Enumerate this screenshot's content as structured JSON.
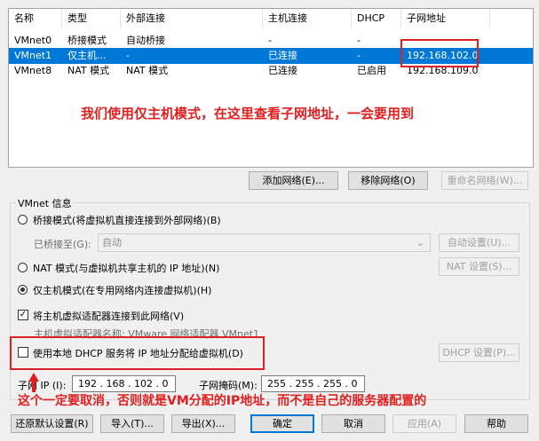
{
  "table": {
    "headers": [
      "名称",
      "类型",
      "外部连接",
      "主机连接",
      "DHCP",
      "子网地址"
    ],
    "rows": [
      {
        "name": "VMnet0",
        "type": "桥接模式",
        "external": "自动桥接",
        "host": "-",
        "dhcp": "-",
        "subnet": ""
      },
      {
        "name": "VMnet1",
        "type": "仅主机...",
        "external": "-",
        "host": "已连接",
        "dhcp": "-",
        "subnet": "192.168.102.0"
      },
      {
        "name": "VMnet8",
        "type": "NAT 模式",
        "external": "NAT 模式",
        "host": "已连接",
        "dhcp": "已启用",
        "subnet": "192.168.109.0"
      }
    ]
  },
  "annotations": {
    "top": "我们使用仅主机模式，在这里查看子网地址，一会要用到",
    "bottom": "这个一定要取消，否则就是VM分配的IP地址，而不是自己的服务器配置的"
  },
  "table_buttons": {
    "add": "添加网络(E)...",
    "remove": "移除网络(O)",
    "rename": "重命名网络(W)..."
  },
  "vmnet_info": {
    "title": "VMnet 信息",
    "bridged_label": "桥接模式(将虚拟机直接连接到外部网络)(B)",
    "bridged_to_label": "已桥接至(G):",
    "bridged_to_value": "自动",
    "auto_settings": "自动设置(U)...",
    "nat_label": "NAT 模式(与虚拟机共享主机的 IP 地址)(N)",
    "nat_settings": "NAT 设置(S)...",
    "hostonly_label": "仅主机模式(在专用网络内连接虚拟机)(H)",
    "connect_adapter_label": "将主机虚拟适配器连接到此网络(V)",
    "adapter_name_label": "主机虚拟适配器名称: VMware 网络适配器 VMnet1",
    "dhcp_label": "使用本地 DHCP 服务将 IP 地址分配给虚拟机(D)",
    "dhcp_settings": "DHCP 设置(P)...",
    "subnet_ip_label": "子网 IP (I):",
    "subnet_ip_value": "192 . 168 . 102 . 0",
    "subnet_mask_label": "子网掩码(M):",
    "subnet_mask_value": "255 . 255 . 255 . 0"
  },
  "footer": {
    "restore": "还原默认设置(R)",
    "import": "导入(T)...",
    "export": "导出(X)...",
    "ok": "确定",
    "cancel": "取消",
    "apply": "应用(A)",
    "help": "帮助"
  },
  "colors": {
    "selection": "#0078d7",
    "annotation": "#e02020"
  }
}
